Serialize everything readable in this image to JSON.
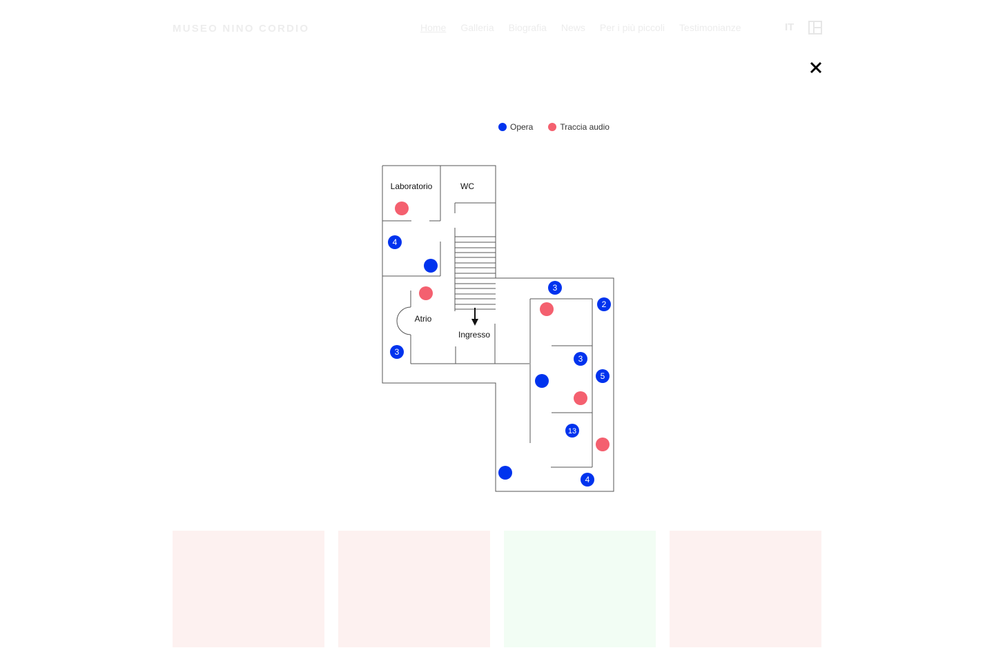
{
  "header": {
    "brand": "MUSEO NINO CORDIO",
    "nav": [
      {
        "label": "Home",
        "active": true
      },
      {
        "label": "Galleria",
        "active": false
      },
      {
        "label": "Biografia",
        "active": false
      },
      {
        "label": "News",
        "active": false
      },
      {
        "label": "Per i più piccoli",
        "active": false
      },
      {
        "label": "Testimonianze",
        "active": false
      }
    ],
    "language": "IT",
    "panel_icon": "panel-toggle-icon"
  },
  "overlay": {
    "close_icon": "close-icon",
    "legend": {
      "opera": {
        "label": "Opera",
        "color": "#0033ee"
      },
      "audio": {
        "label": "Traccia audio",
        "color": "#f4606f"
      }
    },
    "rooms": {
      "laboratorio": "Laboratorio",
      "wc": "WC",
      "atrio": "Atrio",
      "ingresso": "Ingresso"
    },
    "markers": [
      {
        "type": "opera",
        "label": "4"
      },
      {
        "type": "opera",
        "label": ""
      },
      {
        "type": "opera",
        "label": "3"
      },
      {
        "type": "opera",
        "label": "3"
      },
      {
        "type": "opera",
        "label": "2"
      },
      {
        "type": "opera",
        "label": "3"
      },
      {
        "type": "opera",
        "label": "5"
      },
      {
        "type": "opera",
        "label": ""
      },
      {
        "type": "opera",
        "label": "13"
      },
      {
        "type": "opera",
        "label": ""
      },
      {
        "type": "opera",
        "label": "4"
      },
      {
        "type": "audio",
        "label": ""
      },
      {
        "type": "audio",
        "label": ""
      },
      {
        "type": "audio",
        "label": ""
      },
      {
        "type": "audio",
        "label": ""
      },
      {
        "type": "audio",
        "label": ""
      }
    ]
  },
  "cards": [
    {
      "color": "#fdf1f0"
    },
    {
      "color": "#fdf1f0"
    },
    {
      "color": "#f2fdf4"
    },
    {
      "color": "#fdf1f0"
    }
  ]
}
